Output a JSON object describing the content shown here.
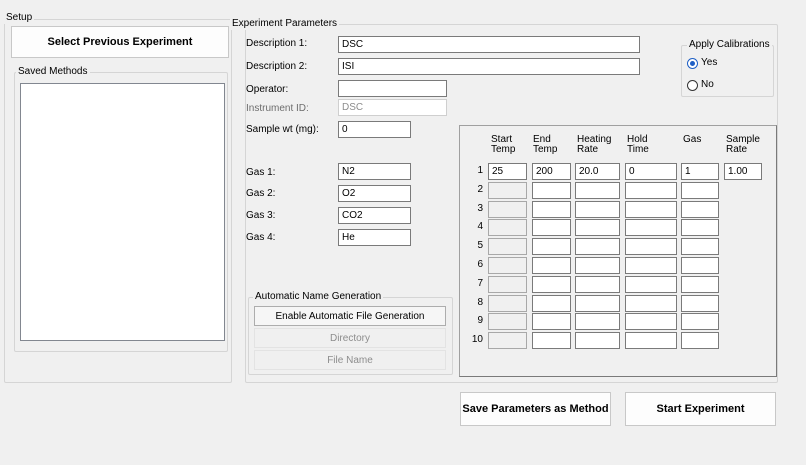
{
  "setup": {
    "title": "Setup",
    "select_previous_label": "Select Previous Experiment",
    "saved_methods": {
      "title": "Saved Methods",
      "items": []
    }
  },
  "experiment": {
    "title": "Experiment Parameters",
    "fields": {
      "description1": {
        "label": "Description 1:",
        "value": "DSC"
      },
      "description2": {
        "label": "Description 2:",
        "value": "ISI"
      },
      "operator": {
        "label": "Operator:",
        "value": ""
      },
      "instrument_id": {
        "label": "Instrument ID:",
        "value": "DSC"
      },
      "sample_wt": {
        "label": "Sample wt (mg):",
        "value": "0"
      }
    },
    "gases": [
      {
        "label": "Gas 1:",
        "value": "N2"
      },
      {
        "label": "Gas 2:",
        "value": "O2"
      },
      {
        "label": "Gas 3:",
        "value": "CO2"
      },
      {
        "label": "Gas 4:",
        "value": "He"
      }
    ],
    "calibrations": {
      "title": "Apply Calibrations",
      "yes_label": "Yes",
      "no_label": "No",
      "selected": "Yes"
    },
    "auto_name": {
      "title": "Automatic Name Generation",
      "enable_label": "Enable Automatic File Generation",
      "directory_label": "Directory",
      "filename_label": "File Name"
    },
    "grid": {
      "headers": {
        "start_temp": [
          "Start",
          "Temp"
        ],
        "end_temp": [
          "End",
          "Temp"
        ],
        "heating_rate": [
          "Heating",
          "Rate"
        ],
        "hold_time": [
          "Hold",
          "Time"
        ],
        "gas": [
          "Gas"
        ],
        "sample_rate": [
          "Sample",
          "Rate"
        ]
      },
      "rows": [
        {
          "num": "1",
          "start": "25",
          "end": "200",
          "rate": "20.0",
          "hold": "0",
          "gas": "1",
          "sample_rate": "1.00"
        },
        {
          "num": "2",
          "start": "",
          "end": "",
          "rate": "",
          "hold": "",
          "gas": ""
        },
        {
          "num": "3",
          "start": "",
          "end": "",
          "rate": "",
          "hold": "",
          "gas": ""
        },
        {
          "num": "4",
          "start": "",
          "end": "",
          "rate": "",
          "hold": "",
          "gas": ""
        },
        {
          "num": "5",
          "start": "",
          "end": "",
          "rate": "",
          "hold": "",
          "gas": ""
        },
        {
          "num": "6",
          "start": "",
          "end": "",
          "rate": "",
          "hold": "",
          "gas": ""
        },
        {
          "num": "7",
          "start": "",
          "end": "",
          "rate": "",
          "hold": "",
          "gas": ""
        },
        {
          "num": "8",
          "start": "",
          "end": "",
          "rate": "",
          "hold": "",
          "gas": ""
        },
        {
          "num": "9",
          "start": "",
          "end": "",
          "rate": "",
          "hold": "",
          "gas": ""
        },
        {
          "num": "10",
          "start": "",
          "end": "",
          "rate": "",
          "hold": "",
          "gas": ""
        }
      ]
    }
  },
  "actions": {
    "save_method_label": "Save Parameters as Method",
    "start_experiment_label": "Start Experiment"
  }
}
